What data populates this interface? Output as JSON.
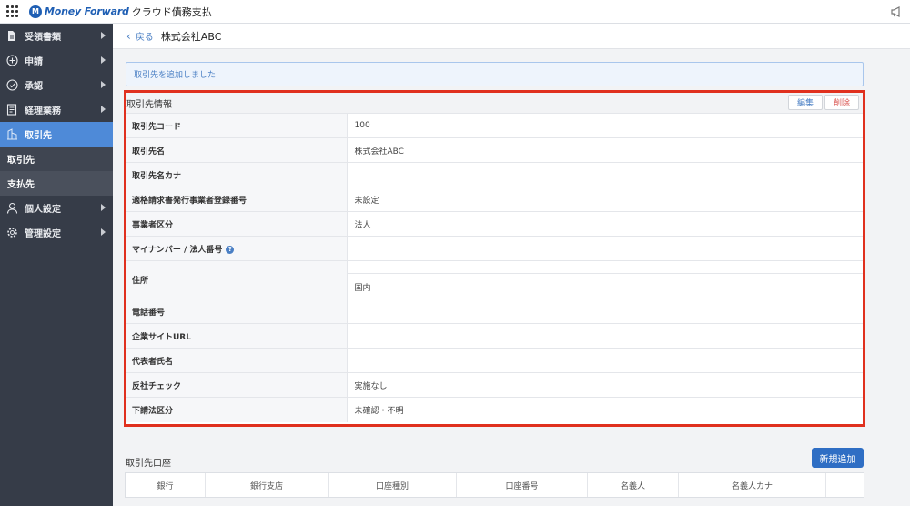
{
  "app": {
    "brand": "Money Forward",
    "product": "クラウド債務支払"
  },
  "sidebar": {
    "items": [
      {
        "label": "受領書類",
        "icon": "document-icon"
      },
      {
        "label": "申請",
        "icon": "plus-circle-icon"
      },
      {
        "label": "承認",
        "icon": "check-circle-icon"
      },
      {
        "label": "経理業務",
        "icon": "ledger-icon"
      },
      {
        "label": "取引先",
        "icon": "building-icon"
      }
    ],
    "sub_items": [
      "取引先",
      "支払先"
    ],
    "bottom_items": [
      {
        "label": "個人設定",
        "icon": "user-icon"
      },
      {
        "label": "管理設定",
        "icon": "gear-icon"
      }
    ]
  },
  "header": {
    "back_label": "戻る",
    "title": "株式会社ABC"
  },
  "notice": "取引先を追加しました",
  "panel": {
    "title": "取引先情報",
    "edit_label": "編集",
    "delete_label": "削除",
    "rows": [
      {
        "label": "取引先コード",
        "value": "100"
      },
      {
        "label": "取引先名",
        "value": "株式会社ABC"
      },
      {
        "label": "取引先名カナ",
        "value": ""
      },
      {
        "label": "適格請求書発行事業者登録番号",
        "value": "未設定"
      },
      {
        "label": "事業者区分",
        "value": "法人"
      },
      {
        "label": "マイナンバー / 法人番号",
        "value": ""
      },
      {
        "label": "住所",
        "value": "国内"
      },
      {
        "label": "電話番号",
        "value": ""
      },
      {
        "label": "企業サイトURL",
        "value": ""
      },
      {
        "label": "代表者氏名",
        "value": ""
      },
      {
        "label": "反社チェック",
        "value": "実施なし"
      },
      {
        "label": "下請法区分",
        "value": "未確認・不明"
      }
    ]
  },
  "accounts": {
    "title": "取引先口座",
    "new_button": "新規追加",
    "columns": [
      "銀行",
      "銀行支店",
      "口座種別",
      "口座番号",
      "名義人",
      "名義人カナ",
      ""
    ]
  }
}
